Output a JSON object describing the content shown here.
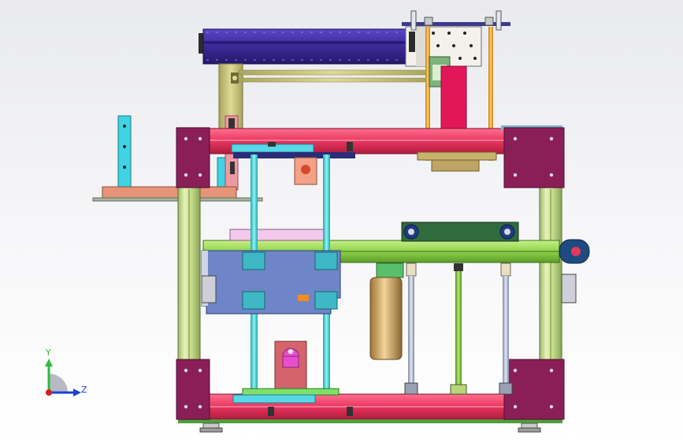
{
  "viewport": {
    "background_top": "#e9eaee",
    "background_bottom": "#ffffff"
  },
  "triad": {
    "y_label": "Y",
    "z_label": "Z",
    "y_color": "#2dbb3a",
    "z_color": "#1d3fd8",
    "origin_color": "#d81c1c"
  },
  "colors": {
    "frame_red": "#e8355e",
    "frame_corner": "#8a1f57",
    "post_green": "#d7e8a4",
    "linear_module": "#3d2a96",
    "gantry_khaki": "#c8c47d",
    "rod_cyan": "#3fd8d8",
    "plate_blue": "#6e86c8",
    "cylinder_bronze": "#d1aa6a",
    "belt_green": "#2f6b3d",
    "rod_orange": "#f2a624"
  }
}
